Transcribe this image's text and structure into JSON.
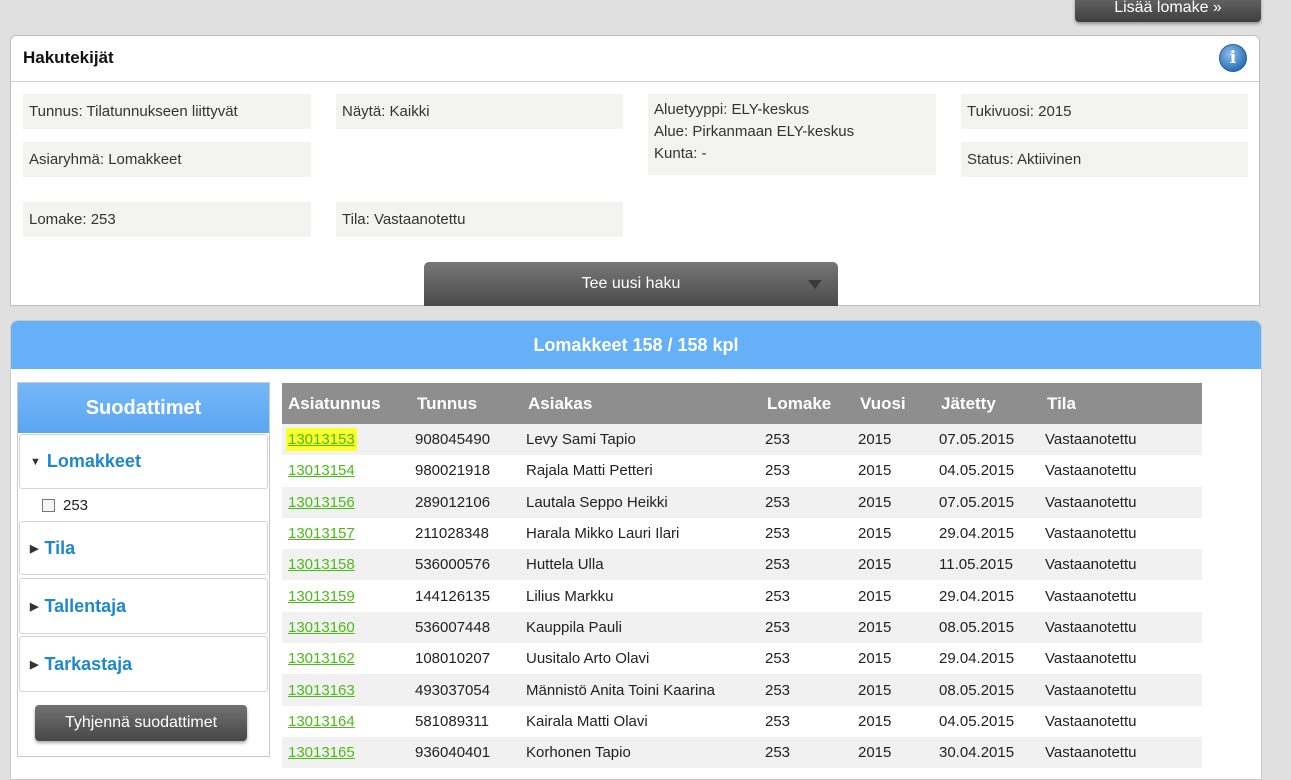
{
  "top_button": {
    "label": "Lisää lomake »"
  },
  "search": {
    "title": "Hakutekijät",
    "criteria": {
      "tunnus": "Tunnus: Tilatunnukseen liittyvät",
      "nayta": "Näytä: Kaikki",
      "aluetyyppi": "Aluetyyppi: ELY-keskus",
      "alue": "Alue: Pirkanmaan ELY-keskus",
      "kunta": "Kunta: -",
      "tukivuosi": "Tukivuosi: 2015",
      "asiaryhma": "Asiaryhmä: Lomakkeet",
      "status": "Status: Aktiivinen",
      "lomake": "Lomake: 253",
      "tila": "Tila: Vastaanotettu"
    },
    "new_search_label": "Tee uusi haku"
  },
  "results": {
    "header": "Lomakkeet 158 / 158 kpl",
    "filters": {
      "title": "Suodattimet",
      "facets": [
        {
          "label": "Lomakkeet",
          "expanded": true,
          "options": [
            {
              "label": "253",
              "checked": false
            }
          ]
        },
        {
          "label": "Tila",
          "expanded": false
        },
        {
          "label": "Tallentaja",
          "expanded": false
        },
        {
          "label": "Tarkastaja",
          "expanded": false
        }
      ],
      "clear_label": "Tyhjennä suodattimet"
    },
    "table": {
      "columns": [
        "Asiatunnus",
        "Tunnus",
        "Asiakas",
        "Lomake",
        "Vuosi",
        "Jätetty",
        "Tila"
      ],
      "rows": [
        [
          "13013153",
          "908045490",
          "Levy Sami Tapio",
          "253",
          "2015",
          "07.05.2015",
          "Vastaanotettu"
        ],
        [
          "13013154",
          "980021918",
          "Rajala Matti Petteri",
          "253",
          "2015",
          "04.05.2015",
          "Vastaanotettu"
        ],
        [
          "13013156",
          "289012106",
          "Lautala Seppo Heikki",
          "253",
          "2015",
          "07.05.2015",
          "Vastaanotettu"
        ],
        [
          "13013157",
          "211028348",
          "Harala Mikko Lauri Ilari",
          "253",
          "2015",
          "29.04.2015",
          "Vastaanotettu"
        ],
        [
          "13013158",
          "536000576",
          "Huttela Ulla",
          "253",
          "2015",
          "11.05.2015",
          "Vastaanotettu"
        ],
        [
          "13013159",
          "144126135",
          "Lilius Markku",
          "253",
          "2015",
          "29.04.2015",
          "Vastaanotettu"
        ],
        [
          "13013160",
          "536007448",
          "Kauppila Pauli",
          "253",
          "2015",
          "08.05.2015",
          "Vastaanotettu"
        ],
        [
          "13013162",
          "108010207",
          "Uusitalo Arto Olavi",
          "253",
          "2015",
          "29.04.2015",
          "Vastaanotettu"
        ],
        [
          "13013163",
          "493037054",
          "Männistö Anita Toini Kaarina",
          "253",
          "2015",
          "08.05.2015",
          "Vastaanotettu"
        ],
        [
          "13013164",
          "581089311",
          "Kairala Matti Olavi",
          "253",
          "2015",
          "04.05.2015",
          "Vastaanotettu"
        ],
        [
          "13013165",
          "936040401",
          "Korhonen Tapio",
          "253",
          "2015",
          "30.04.2015",
          "Vastaanotettu"
        ]
      ],
      "highlighted_row": 0
    }
  },
  "icons": {
    "info": "info-icon"
  },
  "colors": {
    "header_blue": "#66b0f8",
    "link_green": "#4cba18",
    "highlight_yellow": "#fbff2a",
    "table_header_gray": "#8e8e8e"
  }
}
